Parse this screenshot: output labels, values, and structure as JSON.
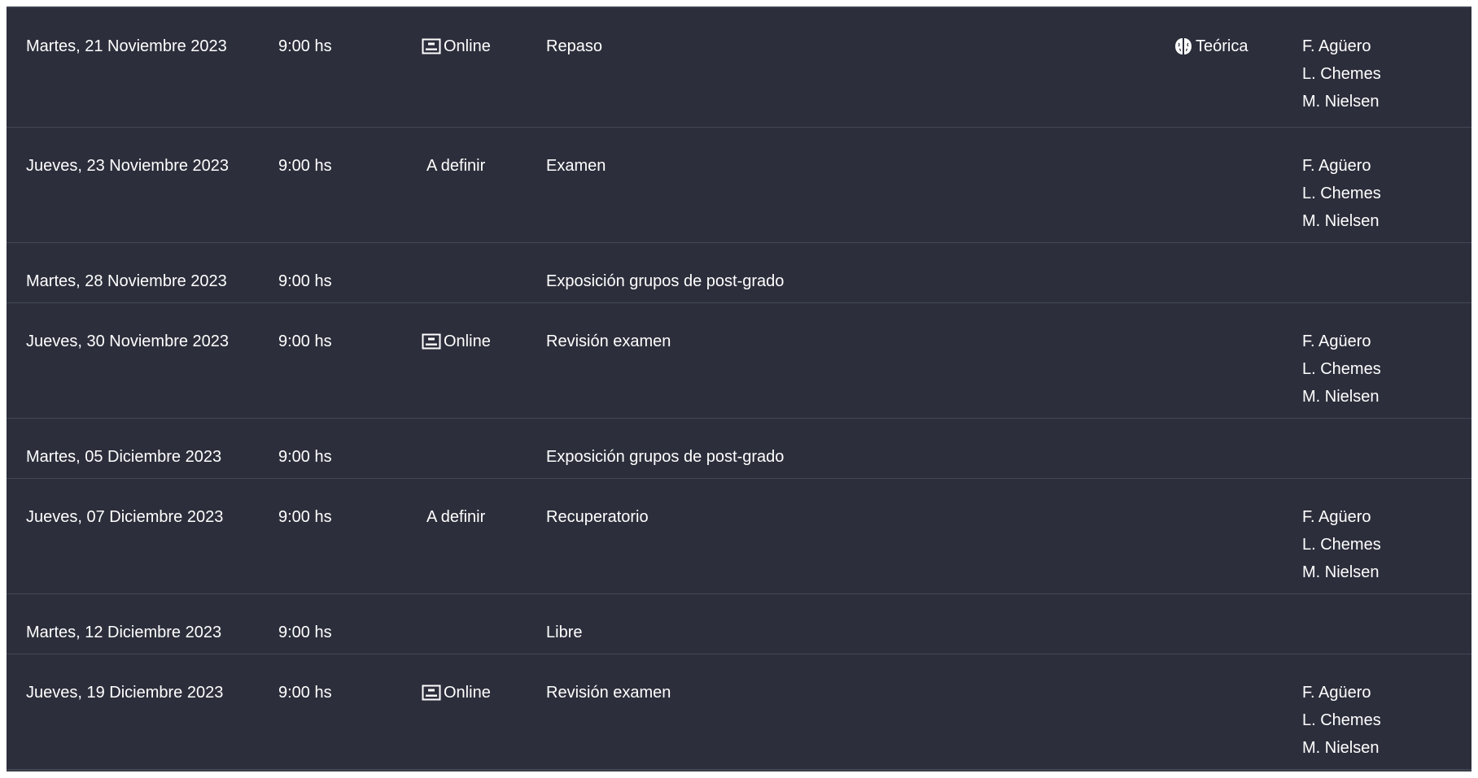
{
  "schedule": {
    "rows": [
      {
        "date": "Martes, 21 Noviembre 2023",
        "time": "9:00 hs",
        "mode": "Online",
        "mode_icon": "monitor-icon",
        "topic": "Repaso",
        "kind": "Teórica",
        "kind_icon": "brain-icon",
        "teachers": [
          "F. Agüero",
          "L. Chemes",
          "M. Nielsen"
        ]
      },
      {
        "date": "Jueves, 23 Noviembre 2023",
        "time": "9:00 hs",
        "mode": "A definir",
        "topic": "Examen",
        "kind": "",
        "teachers": [
          "F. Agüero",
          "L. Chemes",
          "M. Nielsen"
        ]
      },
      {
        "date": "Martes, 28 Noviembre 2023",
        "time": "9:00 hs",
        "mode": "",
        "topic": "Exposición grupos de post-grado",
        "kind": "",
        "teachers": []
      },
      {
        "date": "Jueves, 30 Noviembre 2023",
        "time": "9:00 hs",
        "mode": "Online",
        "mode_icon": "monitor-icon",
        "topic": "Revisión examen",
        "kind": "",
        "teachers": [
          "F. Agüero",
          "L. Chemes",
          "M. Nielsen"
        ]
      },
      {
        "date": "Martes, 05 Diciembre 2023",
        "time": "9:00 hs",
        "mode": "",
        "topic": "Exposición grupos de post-grado",
        "kind": "",
        "teachers": []
      },
      {
        "date": "Jueves, 07 Diciembre 2023",
        "time": "9:00 hs",
        "mode": "A definir",
        "topic": "Recuperatorio",
        "kind": "",
        "teachers": [
          "F. Agüero",
          "L. Chemes",
          "M. Nielsen"
        ]
      },
      {
        "date": "Martes, 12 Diciembre 2023",
        "time": "9:00 hs",
        "mode": "",
        "topic": "Libre",
        "kind": "",
        "teachers": []
      },
      {
        "date": "Jueves, 19 Diciembre 2023",
        "time": "9:00 hs",
        "mode": "Online",
        "mode_icon": "monitor-icon",
        "topic": "Revisión examen",
        "kind": "",
        "teachers": [
          "F. Agüero",
          "L. Chemes",
          "M. Nielsen"
        ]
      }
    ]
  },
  "colors": {
    "background": "#2c2e3b",
    "text": "#ffffff",
    "divider": "#444756"
  }
}
